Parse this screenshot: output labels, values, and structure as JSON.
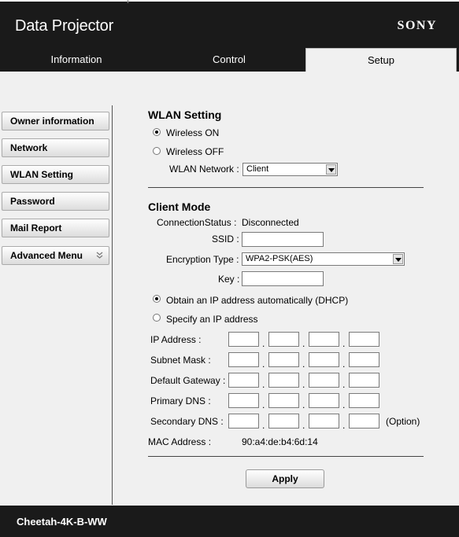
{
  "header": {
    "title": "Data Projector",
    "brand": "SONY",
    "tabs": [
      {
        "label": "Information"
      },
      {
        "label": "Control"
      },
      {
        "label": "Setup"
      }
    ]
  },
  "sidebar": {
    "items": [
      {
        "label": "Owner information"
      },
      {
        "label": "Network"
      },
      {
        "label": "WLAN Setting"
      },
      {
        "label": "Password"
      },
      {
        "label": "Mail Report"
      },
      {
        "label": "Advanced Menu",
        "icon": "double-chevron-down-icon"
      }
    ]
  },
  "wlan": {
    "title": "WLAN Setting",
    "wireless_on": "Wireless ON",
    "wireless_off": "Wireless OFF",
    "wireless_state": "on",
    "network_label": "WLAN Network :",
    "network_value": "Client"
  },
  "client": {
    "title": "Client Mode",
    "status_label": "ConnectionStatus :",
    "status_value": "Disconnected",
    "ssid_label": "SSID :",
    "ssid_value": "",
    "encryption_label": "Encryption Type :",
    "encryption_value": "WPA2-PSK(AES)",
    "key_label": "Key :",
    "key_value": "",
    "dhcp_label": "Obtain an IP address automatically (DHCP)",
    "static_label": "Specify an IP address",
    "ip_mode": "dhcp",
    "ip_address_label": "IP Address :",
    "subnet_label": "Subnet Mask :",
    "gateway_label": "Default Gateway :",
    "primary_dns_label": "Primary DNS :",
    "secondary_dns_label": "Secondary DNS :",
    "option_label": "(Option)",
    "mac_label": "MAC Address :",
    "mac_value": "90:a4:de:b4:6d:14",
    "apply_label": "Apply",
    "separator": "."
  },
  "footer": {
    "model": "Cheetah-4K-B-WW"
  }
}
